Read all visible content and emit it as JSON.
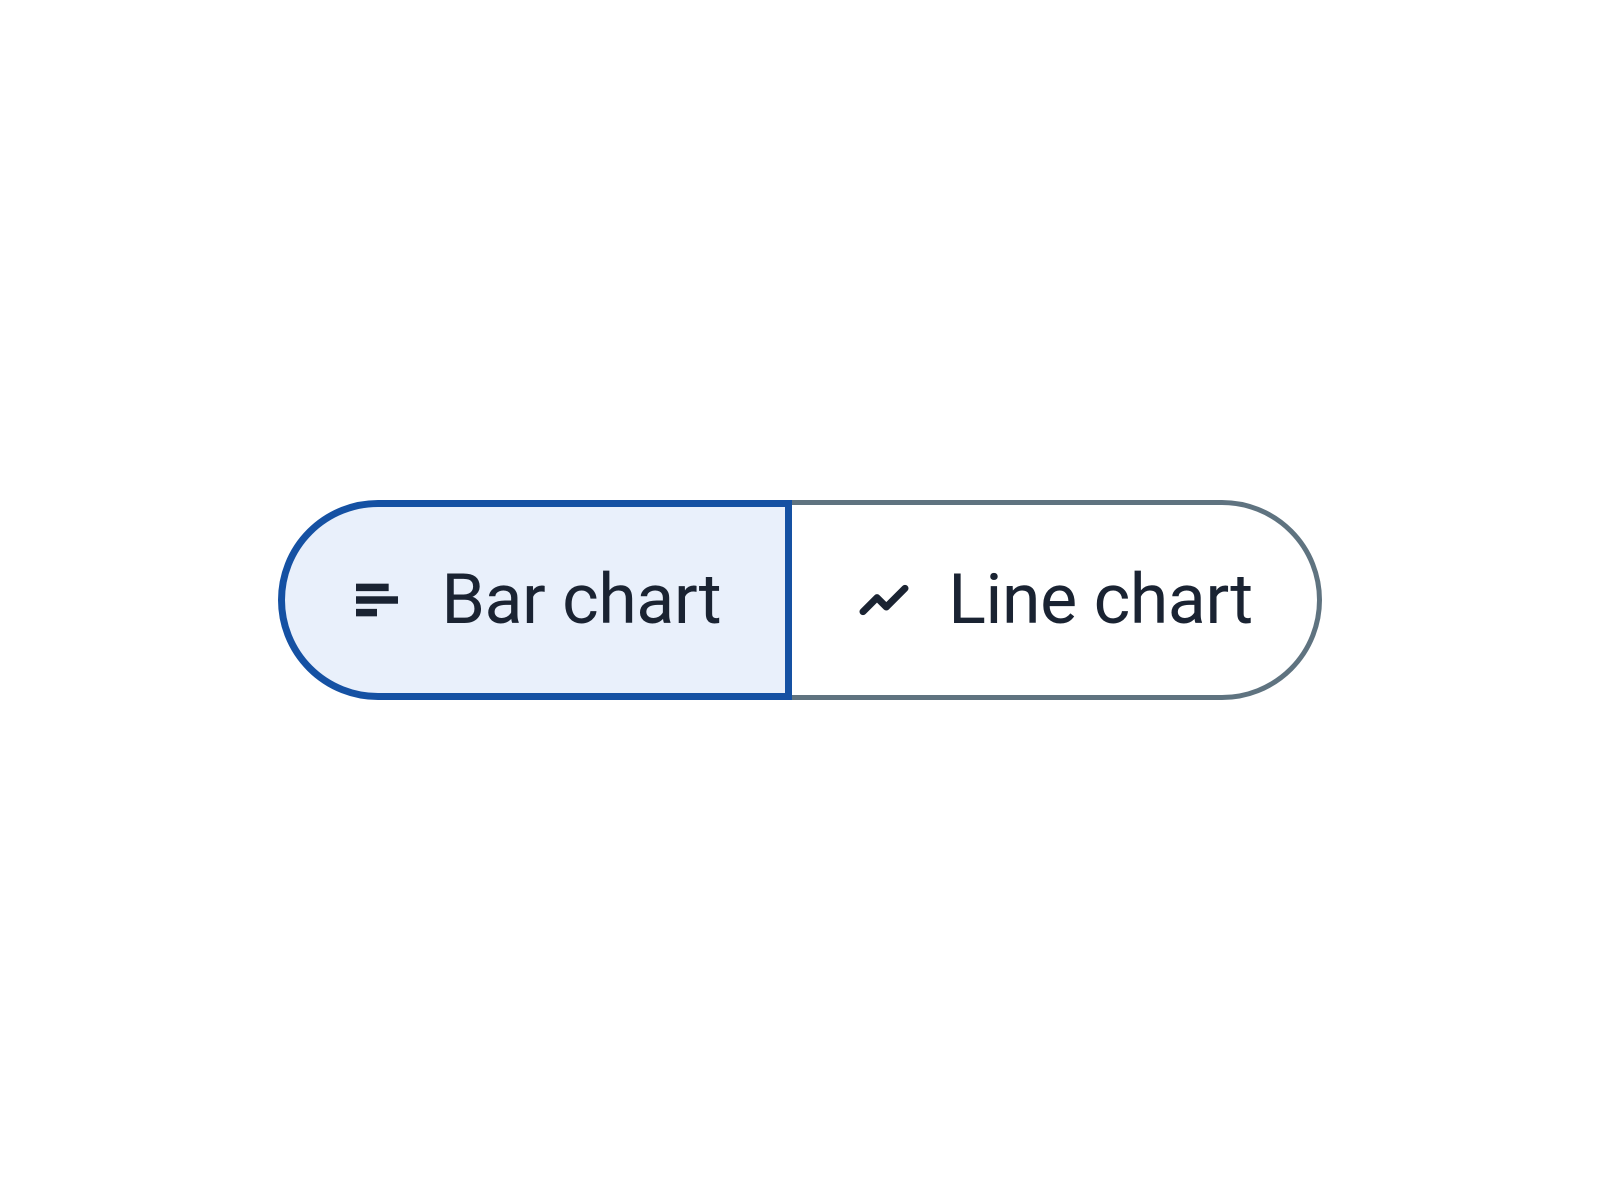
{
  "toggle": {
    "options": [
      {
        "label": "Bar chart",
        "icon": "bar-chart-icon",
        "selected": true
      },
      {
        "label": "Line chart",
        "icon": "line-chart-icon",
        "selected": false
      }
    ]
  },
  "colors": {
    "selected_border": "#1551a3",
    "selected_bg": "#e9f0fb",
    "unselected_border": "#5f7380",
    "text": "#1a2332"
  }
}
